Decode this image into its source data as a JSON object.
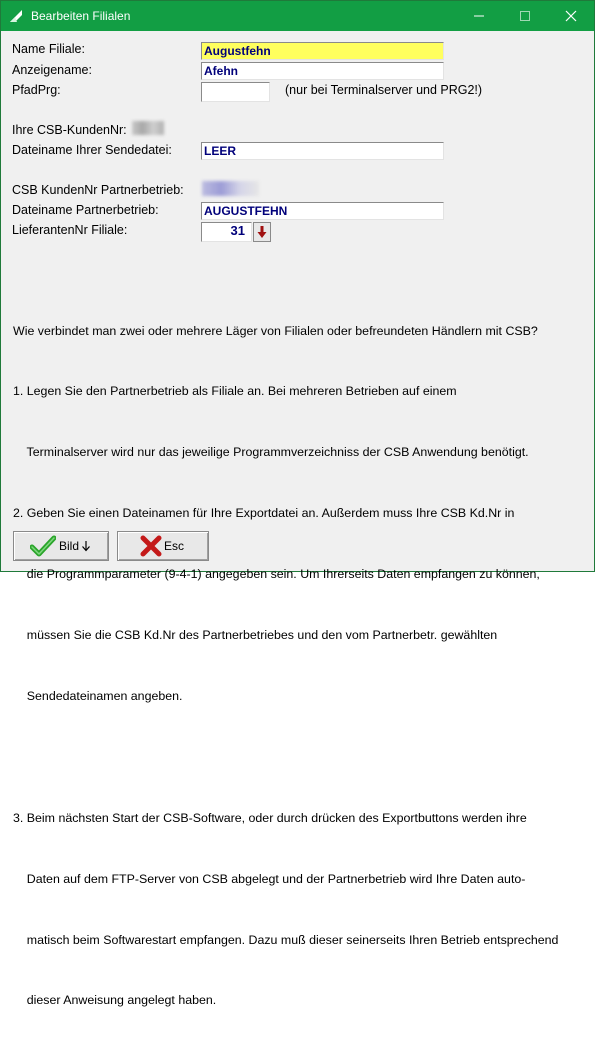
{
  "window": {
    "title": "Bearbeiten Filialen",
    "accent": "#129e44",
    "controls": {
      "minimize": "—",
      "maximize": "☐",
      "close": "✕"
    }
  },
  "form": {
    "name_filiale_label": "Name Filiale:",
    "name_filiale_value": "Augustfehn",
    "anzeigename_label": "Anzeigename:",
    "anzeigename_value": "Afehn",
    "pfadprg_label": "PfadPrg:",
    "pfadprg_value": "",
    "pfadprg_hint": "(nur bei Terminalserver und PRG2!)",
    "kundennr_label": "Ihre CSB-KundenNr:",
    "sendedatei_label": "Dateiname Ihrer Sendedatei:",
    "sendedatei_value": "LEER",
    "partner_kundennr_label": "CSB KundenNr Partnerbetrieb:",
    "partner_datei_label": "Dateiname Partnerbetrieb:",
    "partner_datei_value": "AUGUSTFEHN",
    "lieferanten_label": "LieferantenNr Filiale:",
    "lieferanten_value": "31",
    "highlight_color": "#ffff5e",
    "value_color": "#00007a"
  },
  "info": {
    "lines": [
      "Wie verbindet man zwei oder mehrere Läger von Filialen oder befreundeten Händlern mit CSB?",
      "1. Legen Sie den Partnerbetrieb als Filiale an. Bei mehreren Betrieben auf einem",
      "    Terminalserver wird nur das jeweilige Programmverzeichniss der CSB Anwendung benötigt.",
      "2. Geben Sie einen Dateinamen für Ihre Exportdatei an. Außerdem muss Ihre CSB Kd.Nr in",
      "    die Programmparameter (9-4-1) angegeben sein. Um Ihrerseits Daten empfangen zu können,",
      "    müssen Sie die CSB Kd.Nr des Partnerbetriebes und den vom Partnerbetr. gewählten",
      "    Sendedateinamen angeben.",
      "",
      "3. Beim nächsten Start der CSB-Software, oder durch drücken des Exportbuttons werden ihre",
      "    Daten auf dem FTP-Server von CSB abgelegt und der Partnerbetrieb wird Ihre Daten auto-",
      "    matisch beim Softwarestart empfangen. Dazu muß dieser seinerseits Ihren Betrieb entsprechend",
      "    dieser Anweisung angelegt haben."
    ]
  },
  "buttons": {
    "bild_label": "Bild",
    "esc_label": "Esc"
  }
}
